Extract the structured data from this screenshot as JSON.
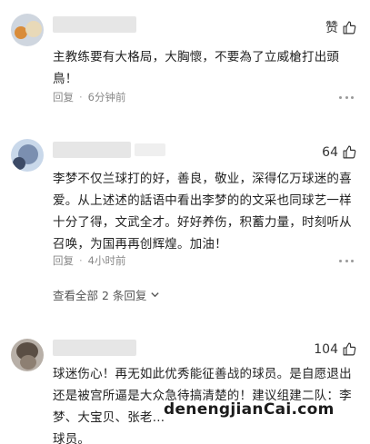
{
  "comments": [
    {
      "like_label": "赞",
      "text": "主教练要有大格局，大胸懷，不要為了立威槍打出頭鳥！",
      "reply_label": "回复",
      "time": "6分钟前"
    },
    {
      "like_label": "64",
      "text": "李梦不仅兰球打的好，善良，敬业，深得亿万球迷的喜爱。从上述述的話语中看出李梦的的文采也同球艺一样十分了得，文武全才。好好养伤，积蓄力量，时刻听从召唤，为国再再创辉煌。加油！",
      "reply_label": "回复",
      "time": "4小时前",
      "view_all": "查看全部 2 条回复"
    },
    {
      "like_label": "104",
      "text": "球迷伤心！再无如此优秀能征善战的球员。是自愿退出还是被宫所逼是大众急待搞清楚的！建议组建二队：李梦、大宝贝、张老…",
      "text_tail": "球员。"
    }
  ],
  "watermark": "denengjianCai.com",
  "icons": {
    "like": "thumbs-up-icon",
    "more": "more-dots-icon",
    "expand": "chevron-down-icon"
  }
}
